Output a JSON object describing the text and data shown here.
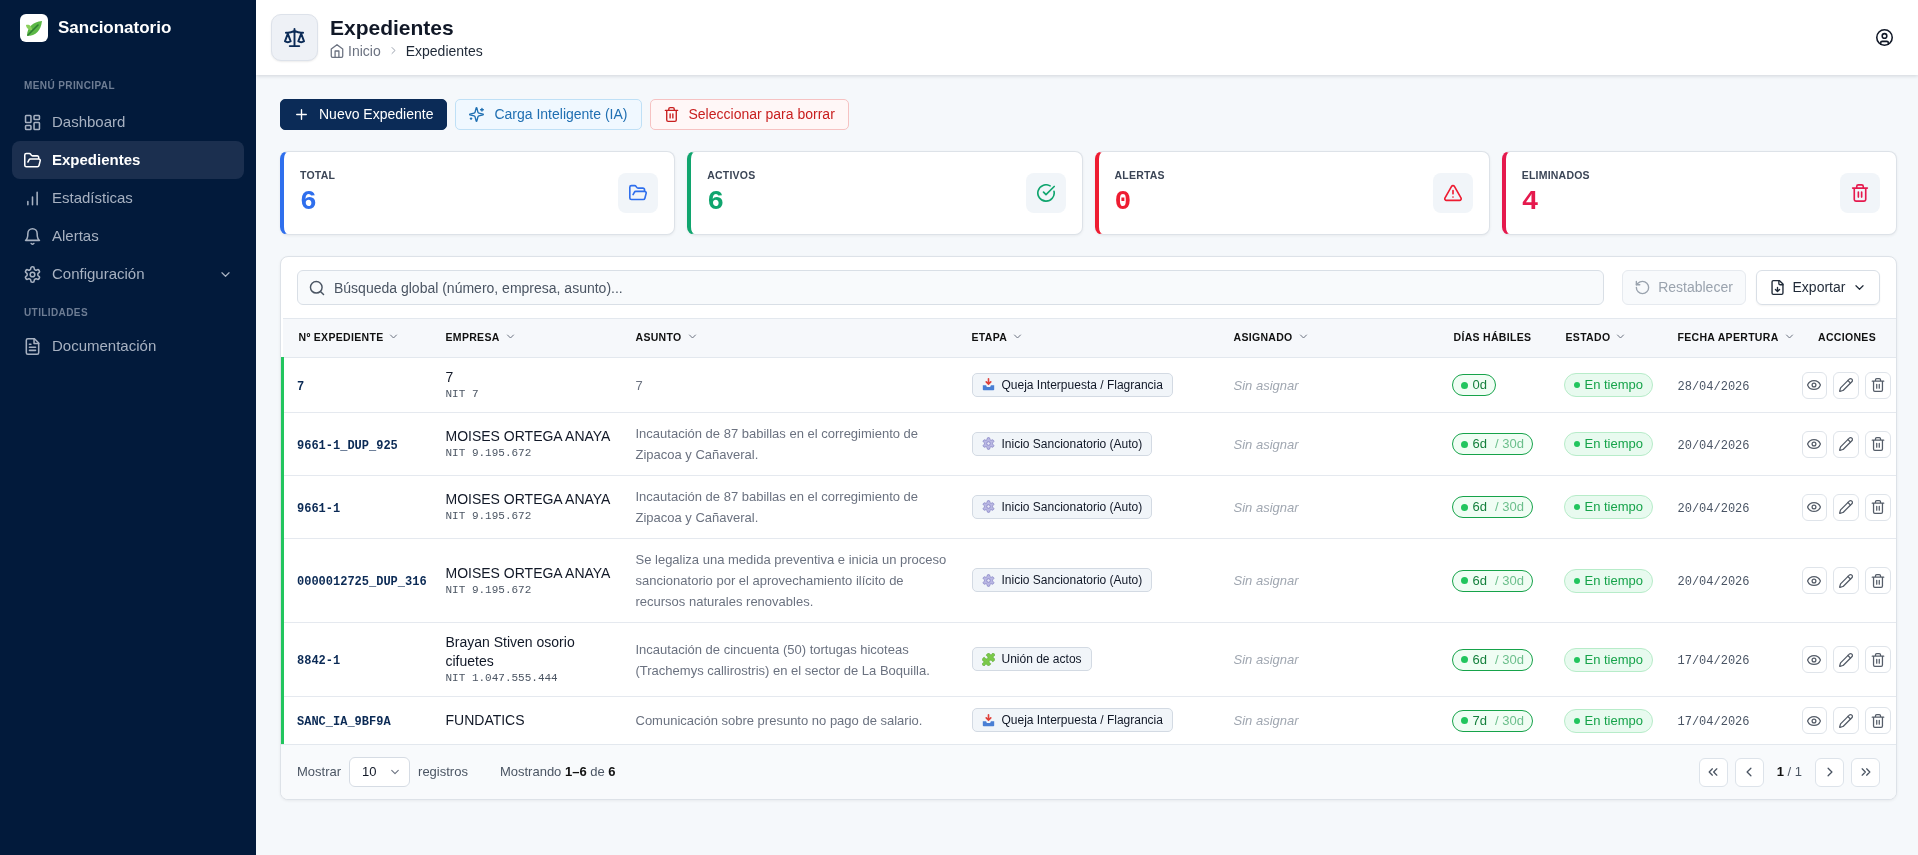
{
  "sidebar": {
    "brand": "Sancionatorio",
    "sections": [
      {
        "title": "MENÚ PRINCIPAL",
        "items": [
          {
            "label": "Dashboard",
            "kind": "link",
            "selected": false
          },
          {
            "label": "Expedientes",
            "kind": "link",
            "selected": true
          },
          {
            "label": "Estadísticas",
            "kind": "link",
            "selected": false
          },
          {
            "label": "Alertas",
            "kind": "link",
            "selected": false
          },
          {
            "label": "Configuración",
            "kind": "group",
            "selected": false,
            "expanded": false
          }
        ]
      },
      {
        "title": "UTILIDADES",
        "items": [
          {
            "label": "Documentación",
            "kind": "link",
            "selected": false
          }
        ]
      }
    ]
  },
  "header": {
    "title": "Expedientes",
    "breadcrumb": [
      {
        "label": "Inicio",
        "current": false
      },
      {
        "label": "Expedientes",
        "current": true
      }
    ]
  },
  "actions": [
    {
      "label": "Nuevo Expediente",
      "kind": "primary"
    },
    {
      "label": "Carga Inteligente (IA)",
      "kind": "ai"
    },
    {
      "label": "Seleccionar para borrar",
      "kind": "danger"
    }
  ],
  "stats": [
    {
      "label": "TOTAL",
      "value": "6",
      "color": "#2f6fed",
      "kind": "folder"
    },
    {
      "label": "ACTIVOS",
      "value": "6",
      "color": "#10a56e",
      "kind": "check"
    },
    {
      "label": "ALERTAS",
      "value": "0",
      "color": "#ee1c31",
      "kind": "alert"
    },
    {
      "label": "ELIMINADOS",
      "value": "4",
      "color": "#e5194d",
      "kind": "trash"
    }
  ],
  "table": {
    "search": {
      "placeholder": "Búsqueda global (número, empresa, asunto)..."
    },
    "reset": {
      "label": "Restablecer",
      "disabled": true
    },
    "export": {
      "label": "Exportar"
    },
    "columns": [
      {
        "label": "Nº EXPEDIENTE",
        "sortable": true
      },
      {
        "label": "EMPRESA",
        "sortable": true
      },
      {
        "label": "ASUNTO",
        "sortable": true
      },
      {
        "label": "ETAPA",
        "sortable": true
      },
      {
        "label": "ASIGNADO",
        "sortable": true
      },
      {
        "label": "DÍAS HÁBILES",
        "sortable": false
      },
      {
        "label": "ESTADO",
        "sortable": true
      },
      {
        "label": "FECHA APERTURA",
        "sortable": true
      },
      {
        "label": "ACCIONES",
        "sortable": false
      }
    ],
    "rows": [
      {
        "number": "7",
        "company": "7",
        "nit": "NIT 7",
        "subject": "7",
        "stage": {
          "label": "Queja Interpuesta / Flagrancia",
          "kind": "complaint"
        },
        "assignee": "Sin asignar",
        "days": "0d",
        "status": "En tiempo",
        "opened": "28/04/2026"
      },
      {
        "number": "9661-1_DUP_925",
        "company": "MOISES ORTEGA ANAYA",
        "nit": "NIT 9.195.672",
        "subject": "Incautación de 87 babillas en el corregimiento de Zipacoa y Cañaveral.",
        "stage": {
          "label": "Inicio Sancionatorio (Auto)",
          "kind": "start"
        },
        "assignee": "Sin asignar",
        "days": "6d",
        "limit": "/ 30d",
        "status": "En tiempo",
        "opened": "20/04/2026"
      },
      {
        "number": "9661-1",
        "company": "MOISES ORTEGA ANAYA",
        "nit": "NIT 9.195.672",
        "subject": "Incautación de 87 babillas en el corregimiento de Zipacoa y Cañaveral.",
        "stage": {
          "label": "Inicio Sancionatorio (Auto)",
          "kind": "start"
        },
        "assignee": "Sin asignar",
        "days": "6d",
        "limit": "/ 30d",
        "status": "En tiempo",
        "opened": "20/04/2026"
      },
      {
        "number": "0000012725_DUP_316",
        "company": "MOISES ORTEGA ANAYA",
        "nit": "NIT 9.195.672",
        "subject": "Se legaliza una medida preventiva e inicia un proceso sancionatorio por el aprovechamiento ilícito de recursos naturales renovables.",
        "stage": {
          "label": "Inicio Sancionatorio (Auto)",
          "kind": "start"
        },
        "assignee": "Sin asignar",
        "days": "6d",
        "limit": "/ 30d",
        "status": "En tiempo",
        "opened": "20/04/2026"
      },
      {
        "number": "8842-1",
        "company": "Brayan Stiven osorio cifuetes",
        "nit": "NIT 1.047.555.444",
        "subject": "Incautación de cincuenta (50) tortugas hicoteas (Trachemys callirostris) en el sector de La Boquilla.",
        "stage": {
          "label": "Unión de actos",
          "kind": "merge"
        },
        "assignee": "Sin asignar",
        "days": "6d",
        "limit": "/ 30d",
        "status": "En tiempo",
        "opened": "17/04/2026"
      },
      {
        "number": "SANC_IA_9BF9A",
        "company": "FUNDATICS",
        "subject": "Comunicación sobre presunto no pago de salario.",
        "stage": {
          "label": "Queja Interpuesta / Flagrancia",
          "kind": "complaint"
        },
        "assignee": "Sin asignar",
        "days": "7d",
        "limit": "/ 30d",
        "status": "En tiempo",
        "opened": "17/04/2026"
      }
    ],
    "footer": {
      "show_label": "Mostrar",
      "page_size": "10",
      "records_label": "registros",
      "summary": "Mostrando **1–6** de **6**",
      "page": "**1** / 1"
    }
  }
}
